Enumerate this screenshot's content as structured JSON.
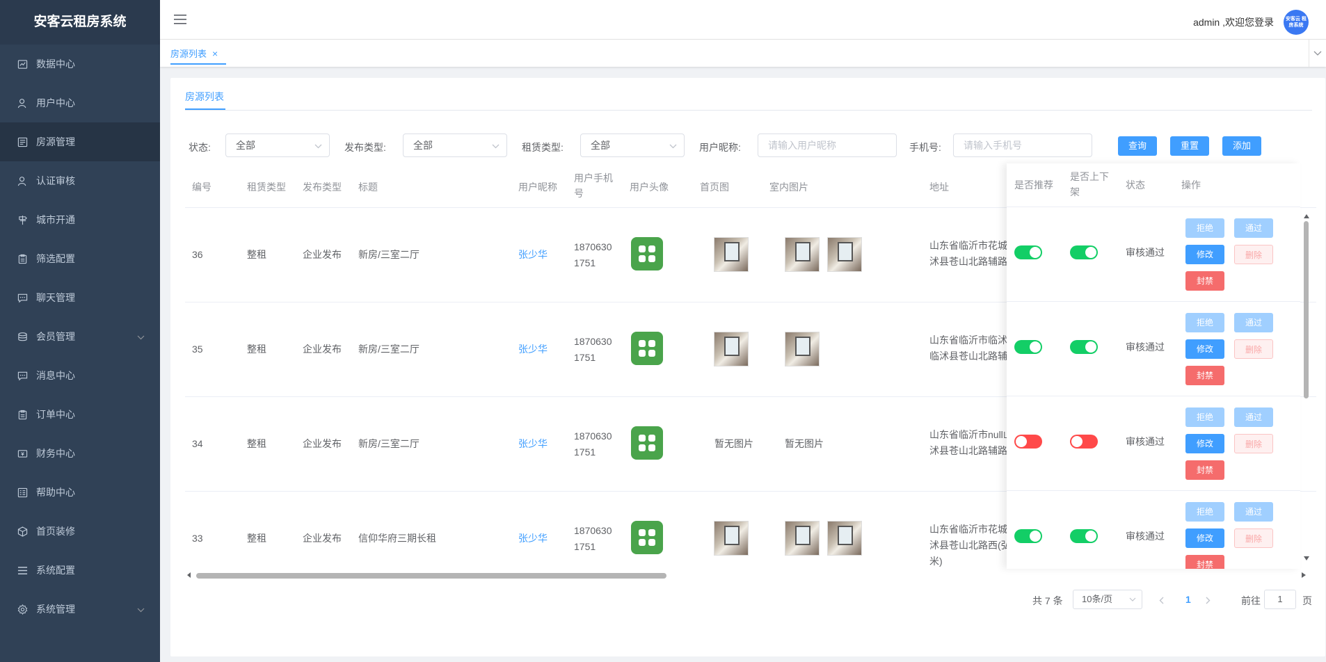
{
  "app": {
    "title": "安客云租房系统"
  },
  "sidebar": {
    "items": [
      {
        "label": "数据中心",
        "icon": "chart-icon"
      },
      {
        "label": "用户中心",
        "icon": "user-icon"
      },
      {
        "label": "房源管理",
        "icon": "list-icon",
        "active": true
      },
      {
        "label": "认证审核",
        "icon": "user-check-icon"
      },
      {
        "label": "城市开通",
        "icon": "signpost-icon"
      },
      {
        "label": "筛选配置",
        "icon": "clipboard-icon"
      },
      {
        "label": "聊天管理",
        "icon": "chat-icon"
      },
      {
        "label": "会员管理",
        "icon": "coins-icon",
        "has_submenu": true
      },
      {
        "label": "消息中心",
        "icon": "message-icon"
      },
      {
        "label": "订单中心",
        "icon": "order-icon"
      },
      {
        "label": "财务中心",
        "icon": "wallet-icon"
      },
      {
        "label": "帮助中心",
        "icon": "help-icon"
      },
      {
        "label": "首页装修",
        "icon": "box-icon"
      },
      {
        "label": "系统配置",
        "icon": "settings-list-icon"
      },
      {
        "label": "系统管理",
        "icon": "gear-icon",
        "has_submenu": true
      }
    ]
  },
  "header": {
    "welcome": "admin ,欢迎您登录",
    "avatar_text": "安客云 租房系统"
  },
  "tags": [
    {
      "label": "房源列表",
      "close": "×"
    }
  ],
  "page": {
    "tab": "房源列表",
    "filters": {
      "status_label": "状态:",
      "status_value": "全部",
      "publish_type_label": "发布类型:",
      "publish_type_value": "全部",
      "rent_type_label": "租赁类型:",
      "rent_type_value": "全部",
      "nickname_label": "用户昵称:",
      "nickname_placeholder": "请输入用户昵称",
      "phone_label": "手机号:",
      "phone_placeholder": "请输入手机号",
      "search_button": "查询",
      "reset_button": "重置",
      "add_button": "添加"
    },
    "columns": [
      "编号",
      "租赁类型",
      "发布类型",
      "标题",
      "用户昵称",
      "用户手机号",
      "用户头像",
      "首页图",
      "室内图片",
      "地址",
      "是否推荐",
      "是否上下架",
      "状态",
      "操作"
    ],
    "rows": [
      {
        "id": "36",
        "rent_type": "整租",
        "publish_type": "企业发布",
        "title": "新房/三室二厅",
        "nickname": "张少华",
        "phone_1": "1870630",
        "phone_2": "1751",
        "cover": "image",
        "indoor_count": 2,
        "cover_text": "",
        "indoor_text": "",
        "address_1": "山东省临沂市花城",
        "address_2": "沭县苍山北路辅路",
        "address_3": "",
        "recommend": true,
        "shelf": true,
        "status": "审核通过"
      },
      {
        "id": "35",
        "rent_type": "整租",
        "publish_type": "企业发布",
        "title": "新房/三室二厅",
        "nickname": "张少华",
        "phone_1": "1870630",
        "phone_2": "1751",
        "cover": "image",
        "indoor_count": 1,
        "cover_text": "",
        "indoor_text": "",
        "address_1": "山东省临沂市临沭",
        "address_2": "临沭县苍山北路辅",
        "address_3": "",
        "recommend": true,
        "shelf": true,
        "status": "审核通过"
      },
      {
        "id": "34",
        "rent_type": "整租",
        "publish_type": "企业发布",
        "title": "新房/三室二厅",
        "nickname": "张少华",
        "phone_1": "1870630",
        "phone_2": "1751",
        "cover": "none",
        "indoor_count": 0,
        "cover_text": "暂无图片",
        "indoor_text": "暂无图片",
        "address_1": "山东省临沂市null山",
        "address_2": "沭县苍山北路辅路",
        "address_3": "",
        "recommend": false,
        "shelf": false,
        "status": "审核通过"
      },
      {
        "id": "33",
        "rent_type": "整租",
        "publish_type": "企业发布",
        "title": "信仰华府三期长租",
        "nickname": "张少华",
        "phone_1": "1870630",
        "phone_2": "1751",
        "cover": "image",
        "indoor_count": 2,
        "cover_text": "",
        "indoor_text": "",
        "address_1": "山东省临沂市花城",
        "address_2": "沭县苍山北路西(弘",
        "address_3": "米)",
        "recommend": true,
        "shelf": true,
        "status": "审核通过"
      }
    ],
    "actions": {
      "reject": "拒绝",
      "pass": "通过",
      "edit": "修改",
      "delete": "删除",
      "ban": "封禁"
    }
  },
  "pagination": {
    "total": "共 7 条",
    "page_size": "10条/页",
    "current_page": "1",
    "goto_prefix": "前往",
    "goto_value": "1",
    "goto_suffix": "页"
  },
  "colors": {
    "sidebar_bg": "#304156",
    "primary": "#409eff",
    "success": "#13ce66",
    "danger": "#ff4949"
  }
}
